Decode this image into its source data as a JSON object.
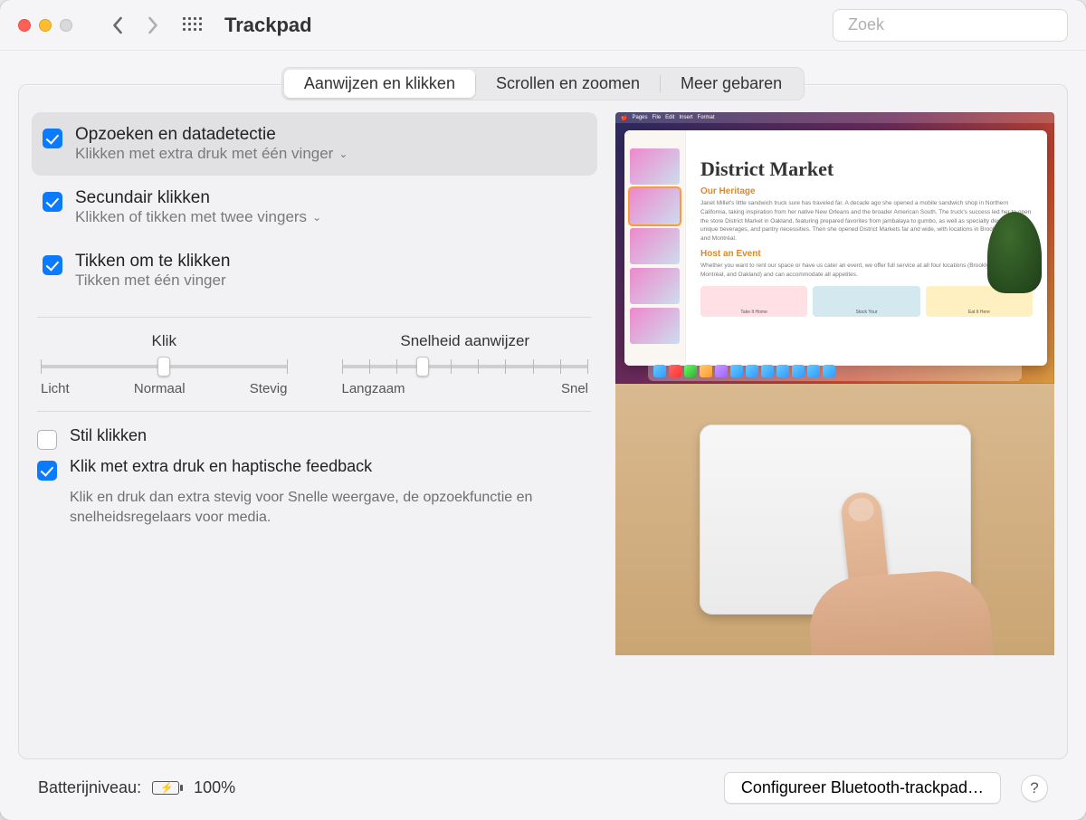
{
  "window": {
    "title": "Trackpad"
  },
  "search": {
    "placeholder": "Zoek"
  },
  "tabs": [
    "Aanwijzen en klikken",
    "Scrollen en zoomen",
    "Meer gebaren"
  ],
  "options": {
    "lookup": {
      "title": "Opzoeken en datadetectie",
      "sub": "Klikken met extra druk met één vinger",
      "checked": true
    },
    "secondary": {
      "title": "Secundair klikken",
      "sub": "Klikken of tikken met twee vingers",
      "checked": true
    },
    "tap": {
      "title": "Tikken om te klikken",
      "sub": "Tikken met één vinger",
      "checked": true
    }
  },
  "sliders": {
    "click": {
      "title": "Klik",
      "labels": [
        "Licht",
        "Normaal",
        "Stevig"
      ],
      "ticks": 3,
      "value_pct": 50
    },
    "tracking": {
      "title": "Snelheid aanwijzer",
      "labels": [
        "Langzaam",
        "Snel"
      ],
      "ticks": 10,
      "value_pct": 33
    }
  },
  "bottom": {
    "silent": {
      "label": "Stil klikken",
      "checked": false
    },
    "force": {
      "label": "Klik met extra druk en haptische feedback",
      "desc": "Klik en druk dan extra stevig voor Snelle weergave, de opzoekfunctie en snelheidsregelaars voor media.",
      "checked": true
    }
  },
  "preview": {
    "doc_title": "District Market",
    "heading1": "Our Heritage",
    "body1": "Janet Millet's little sandwich truck sure has traveled far. A decade ago she opened a mobile sandwich shop in Northern California, taking inspiration from her native New Orleans and the broader American South. The truck's success led her to open the store District Market in Oakland, featuring prepared favorites from jambalaya to gumbo, as well as specialty desserts, unique beverages, and pantry necessities. Then she opened District Markets far and wide, with locations in Brooklyn, London, and Montréal.",
    "highlight": "inspiration",
    "heading2": "Host an Event",
    "body2": "Whether you want to rent our space or have us cater an event, we offer full service at all four locations (Brooklyn, London, Montréal, and Oakland) and can accommodate all appetites.",
    "cards": [
      "Take It Home",
      "Stock Your",
      "Eat It Here"
    ]
  },
  "footer": {
    "battery_label": "Batterijniveau:",
    "battery_pct": "100%",
    "configure": "Configureer Bluetooth-trackpad…",
    "help": "?"
  }
}
